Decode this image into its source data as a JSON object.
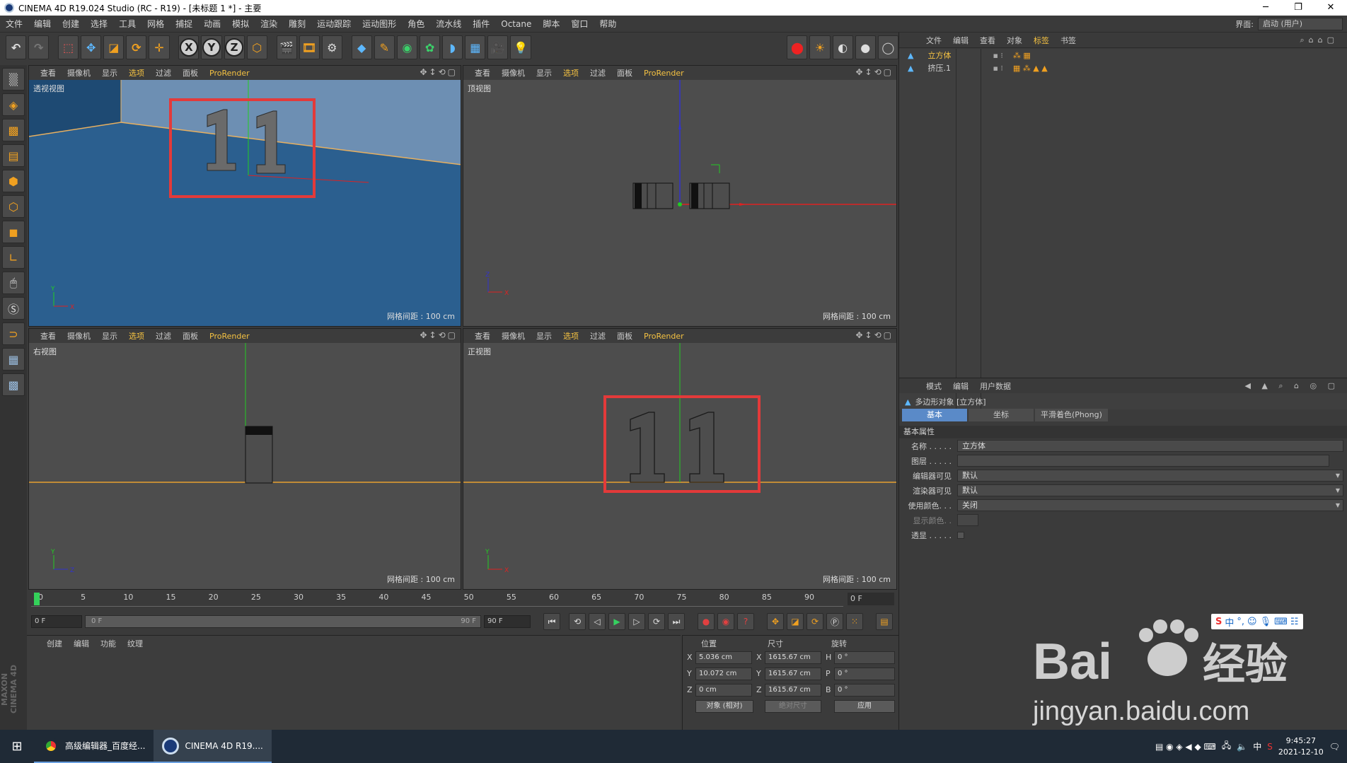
{
  "window": {
    "title": "CINEMA 4D R19.024 Studio (RC - R19) - [未标题 1 *] - 主要",
    "controls": [
      "─",
      "❐",
      "✕"
    ]
  },
  "menu": {
    "items": [
      "文件",
      "编辑",
      "创建",
      "选择",
      "工具",
      "网格",
      "捕捉",
      "动画",
      "模拟",
      "渲染",
      "雕刻",
      "运动跟踪",
      "运动图形",
      "角色",
      "流水线",
      "插件",
      "Octane",
      "脚本",
      "窗口",
      "帮助"
    ],
    "layout_label": "界面:",
    "layout_value": "启动 (用户)"
  },
  "toolbar": {
    "axis_x": "X",
    "axis_y": "Y",
    "axis_z": "Z"
  },
  "viewport_menu": {
    "items": [
      "查看",
      "摄像机",
      "显示",
      "选项",
      "过滤",
      "面板"
    ],
    "prorender": "ProRender",
    "selected_index": 3
  },
  "viewports": [
    {
      "name": "透视视图",
      "grid": "网格间距 : 100 cm"
    },
    {
      "name": "顶视图",
      "grid": "网格间距 : 100 cm"
    },
    {
      "name": "右视图",
      "grid": "网格间距 : 100 cm"
    },
    {
      "name": "正视图",
      "grid": "网格间距 : 100 cm"
    }
  ],
  "object_manager": {
    "menu": [
      "文件",
      "编辑",
      "查看",
      "对象",
      "标签",
      "书签"
    ],
    "selected_menu": "标签",
    "objects": [
      {
        "name": "立方体",
        "selected": true
      },
      {
        "name": "挤压.1",
        "selected": false
      }
    ]
  },
  "attributes": {
    "menu": [
      "模式",
      "编辑",
      "用户数据"
    ],
    "object_title": "多边形对象 [立方体]",
    "tabs": [
      "基本",
      "坐标",
      "平滑着色(Phong)"
    ],
    "active_tab": "基本",
    "section": "基本属性",
    "rows": [
      {
        "label": "名称 . . . . .",
        "value": "立方体"
      },
      {
        "label": "图层 . . . . .",
        "value": ""
      },
      {
        "label": "编辑器可见",
        "value": "默认"
      },
      {
        "label": "渲染器可见",
        "value": "默认"
      },
      {
        "label": "使用颜色. . .",
        "value": "关闭"
      },
      {
        "label": "显示颜色. .",
        "value": ""
      },
      {
        "label": "透显 . . . . .",
        "value": ""
      }
    ]
  },
  "timeline": {
    "ticks": [
      "0",
      "5",
      "10",
      "15",
      "20",
      "25",
      "30",
      "35",
      "40",
      "45",
      "50",
      "55",
      "60",
      "65",
      "70",
      "75",
      "80",
      "85",
      "90"
    ],
    "current_frame": "0 F",
    "start_frame": "0 F",
    "slider_start": "0 F",
    "slider_end": "90 F",
    "end_frame": "90 F"
  },
  "material_manager": {
    "menu": [
      "创建",
      "编辑",
      "功能",
      "纹理"
    ]
  },
  "coordinates": {
    "headers": {
      "position": "位置",
      "size": "尺寸",
      "rotation": "旋转"
    },
    "rows": [
      {
        "axis": "X",
        "pos": "5.036 cm",
        "size_axis": "X",
        "size": "1615.67 cm",
        "rot_axis": "H",
        "rot": "0 °"
      },
      {
        "axis": "Y",
        "pos": "10.072 cm",
        "size_axis": "Y",
        "size": "1615.67 cm",
        "rot_axis": "P",
        "rot": "0 °"
      },
      {
        "axis": "Z",
        "pos": "0 cm",
        "size_axis": "Z",
        "size": "1615.67 cm",
        "rot_axis": "B",
        "rot": "0 °"
      }
    ],
    "mode_select": "对象 (相对)",
    "size_select": "绝对尺寸",
    "apply": "应用"
  },
  "taskbar": {
    "items": [
      {
        "label": "高级编辑器_百度经...",
        "active": false
      },
      {
        "label": "CINEMA 4D R19....",
        "active": true
      }
    ],
    "ime_lang": "中",
    "time": "9:45:27",
    "date": "2021-12-10"
  },
  "watermark": {
    "brand": "Bai",
    "brand_cn": "经验",
    "url": "jingyan.baidu.com"
  },
  "colors": {
    "accent": "#f5c242",
    "selection_box": "#e33a3a",
    "axis_x": "#d22",
    "axis_y": "#2c2",
    "axis_z": "#33c"
  }
}
